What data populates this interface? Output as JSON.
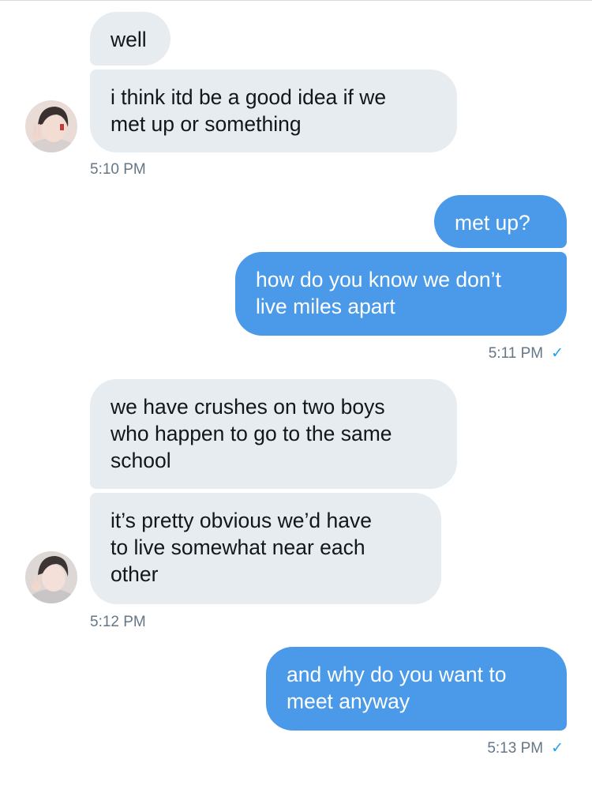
{
  "messages": [
    {
      "id": "m1",
      "direction": "incoming",
      "text": "well"
    },
    {
      "id": "m2",
      "direction": "incoming",
      "text": "i think itd be a good idea if we\nmet up or something"
    },
    {
      "id": "m3",
      "direction": "outgoing",
      "text": "met up?"
    },
    {
      "id": "m4",
      "direction": "outgoing",
      "text": "how do you know we don’t\nlive miles apart"
    },
    {
      "id": "m5",
      "direction": "incoming",
      "text": "we have crushes on two boys\nwho happen to go to the same\nschool"
    },
    {
      "id": "m6",
      "direction": "incoming",
      "text": "it’s pretty obvious we’d have\nto live somewhat near each\nother"
    },
    {
      "id": "m7",
      "direction": "outgoing",
      "text": "and why do you want to\nmeet anyway"
    }
  ],
  "timestamps": {
    "t1": "5:10 PM",
    "t2": "5:11 PM",
    "t3": "5:12 PM",
    "t4": "5:13 PM"
  },
  "read_receipt_icon": "checkmark-icon",
  "colors": {
    "incoming_bubble": "#e6ecf0",
    "outgoing_bubble": "#4a9ae9",
    "timestamp_text": "#657786",
    "read_check": "#1da1f2"
  }
}
